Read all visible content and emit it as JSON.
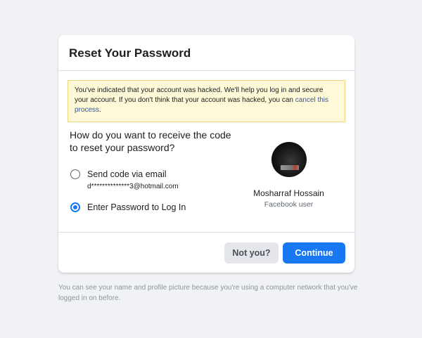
{
  "card": {
    "title": "Reset Your Password",
    "alert": {
      "text": "You've indicated that your account was hacked. We'll help you log in and secure your account. If you don't think that your account was hacked, you can ",
      "link": "cancel this process",
      "suffix": "."
    },
    "question": "How do you want to receive the code to reset your password?",
    "options": [
      {
        "label": "Send code via email",
        "detail": "d**************3@hotmail.com",
        "selected": false
      },
      {
        "label": "Enter Password to Log In",
        "detail": "",
        "selected": true
      }
    ],
    "profile": {
      "name": "Mosharraf Hossain",
      "subtitle": "Facebook user"
    },
    "buttons": {
      "not_you": "Not you?",
      "continue": "Continue"
    }
  },
  "footer_note": "You can see your name and profile picture because you're using a computer network that you've logged in on before.",
  "colors": {
    "primary": "#1877f2",
    "background": "#f0f2f5",
    "alert_bg": "#fff9d7",
    "alert_border": "#f0d77b",
    "link": "#385898"
  }
}
